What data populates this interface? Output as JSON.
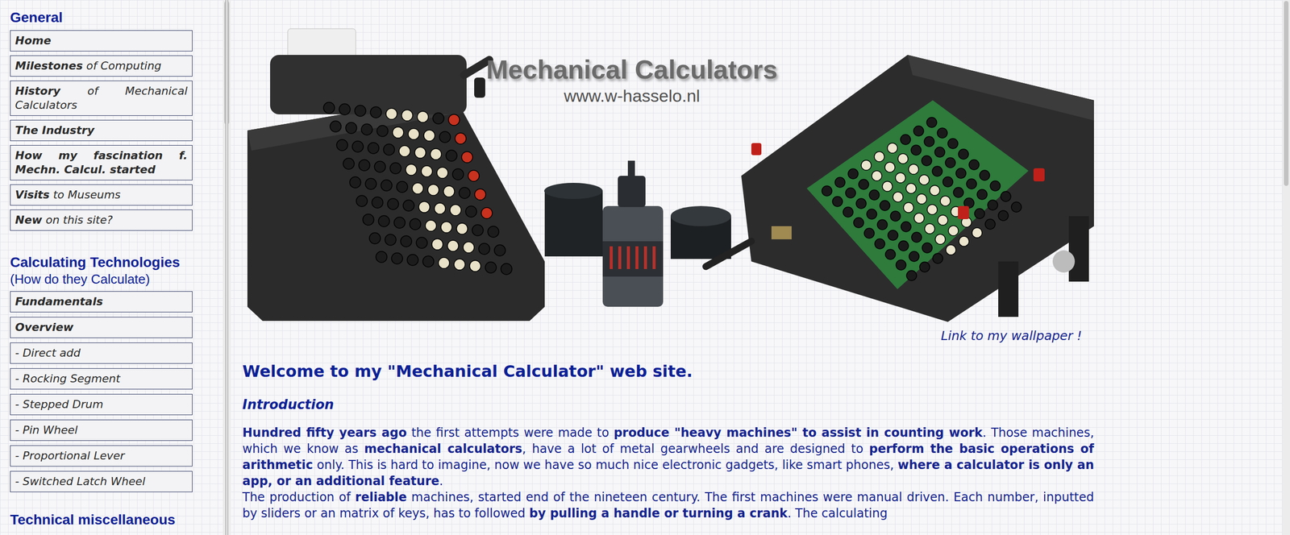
{
  "sidebar": {
    "sections": [
      {
        "title": "General",
        "items": [
          {
            "parts": [
              {
                "text": "Home",
                "bold": true
              }
            ]
          },
          {
            "parts": [
              {
                "text": "Milestones",
                "bold": true
              },
              {
                "text": " of Computing",
                "bold": false
              }
            ]
          },
          {
            "parts": [
              {
                "text": "History",
                "bold": true
              },
              {
                "text": " of Mechanical Calculators",
                "bold": false
              }
            ]
          },
          {
            "parts": [
              {
                "text": "The Industry",
                "bold": true
              }
            ]
          },
          {
            "parts": [
              {
                "text": "How my fascination f. Mechn. Calcul. started",
                "bold": true
              }
            ]
          },
          {
            "parts": [
              {
                "text": "Visits",
                "bold": true
              },
              {
                "text": " to Museums",
                "bold": false
              }
            ]
          },
          {
            "parts": [
              {
                "text": "New",
                "bold": true
              },
              {
                "text": " on this site?",
                "bold": false
              }
            ]
          }
        ]
      },
      {
        "title": "Calculating Technologies",
        "subtitle": "(How do they Calculate)",
        "items": [
          {
            "parts": [
              {
                "text": "Fundamentals",
                "bold": true
              }
            ]
          },
          {
            "parts": [
              {
                "text": "Overview",
                "bold": true
              }
            ]
          },
          {
            "parts": [
              {
                "text": "- Direct add",
                "bold": false
              }
            ]
          },
          {
            "parts": [
              {
                "text": "- Rocking Segment",
                "bold": false
              }
            ]
          },
          {
            "parts": [
              {
                "text": "- Stepped Drum",
                "bold": false
              }
            ]
          },
          {
            "parts": [
              {
                "text": "- Pin Wheel",
                "bold": false
              }
            ]
          },
          {
            "parts": [
              {
                "text": "- Proportional Lever",
                "bold": false
              }
            ]
          },
          {
            "parts": [
              {
                "text": "- Switched Latch Wheel",
                "bold": false
              }
            ]
          }
        ]
      },
      {
        "title": "Technical miscellaneous",
        "items": []
      }
    ]
  },
  "banner": {
    "title": "Mechanical Calculators",
    "url": "www.w-hasselo.nl"
  },
  "wallpaper_link": "Link to my wallpaper !",
  "heading": "Welcome to my \"Mechanical Calculator\" web site.",
  "intro_title": "Introduction",
  "paragraphs": [
    [
      {
        "text": "Hundred fifty years ago",
        "bold": true
      },
      {
        "text": " the first attempts were made to ",
        "bold": false
      },
      {
        "text": "produce \"heavy machines\" to assist in counting work",
        "bold": true
      },
      {
        "text": ". Those machines, which we know as ",
        "bold": false
      },
      {
        "text": "mechanical calculators",
        "bold": true
      },
      {
        "text": ", have a lot of metal gearwheels and are designed to ",
        "bold": false
      },
      {
        "text": "perform the basic operations of arithmetic",
        "bold": true
      },
      {
        "text": " only. This is hard to imagine, now we have so much nice electronic gadgets, like smart phones, ",
        "bold": false
      },
      {
        "text": "where a calculator is only an app, or an additional feature",
        "bold": true
      },
      {
        "text": ".",
        "bold": false
      }
    ],
    [
      {
        "text": "The production of ",
        "bold": false
      },
      {
        "text": "reliable",
        "bold": true
      },
      {
        "text": " machines, started end of the nineteen century. The first machines were manual driven. Each number, inputted by sliders or an matrix of keys, has to followed ",
        "bold": false
      },
      {
        "text": "by pulling a handle or turning a crank",
        "bold": true
      },
      {
        "text": ". The calculating",
        "bold": false
      }
    ]
  ]
}
